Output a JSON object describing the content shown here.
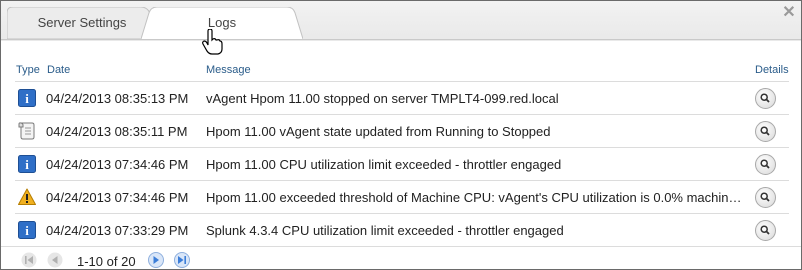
{
  "tabs": [
    {
      "label": "Server Settings",
      "active": false
    },
    {
      "label": "Logs",
      "active": true
    }
  ],
  "table": {
    "columns": {
      "type": "Type",
      "date": "Date",
      "message": "Message",
      "details": "Details"
    },
    "rows": [
      {
        "type": "info-icon",
        "date": "04/24/2013 08:35:13 PM",
        "message": "vAgent Hpom 11.00 stopped on server TMPLT4-099.red.local"
      },
      {
        "type": "scroll-icon",
        "date": "04/24/2013 08:35:11 PM",
        "message": "Hpom 11.00 vAgent state updated from Running to Stopped"
      },
      {
        "type": "info-icon",
        "date": "04/24/2013 07:34:46 PM",
        "message": "Hpom 11.00 CPU utilization limit exceeded - throttler engaged"
      },
      {
        "type": "warning-icon",
        "date": "04/24/2013 07:34:46 PM",
        "message": "Hpom 11.00 exceeded threshold of Machine CPU: vAgent's CPU utilization is 0.0% machin…"
      },
      {
        "type": "info-icon",
        "date": "04/24/2013 07:33:29 PM",
        "message": "Splunk 4.3.4 CPU utilization limit exceeded - throttler engaged"
      }
    ]
  },
  "pager": {
    "range_text": "1-10 of 20"
  },
  "colors": {
    "header_text": "#2a5c8a",
    "info_icon": "#2f6fc7",
    "warning_icon": "#f0b020",
    "pager_button": "#3b7dd8"
  }
}
